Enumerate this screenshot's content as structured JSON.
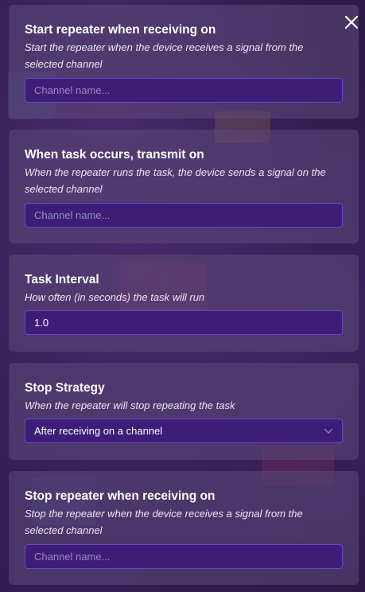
{
  "sections": [
    {
      "title": "Start repeater when receiving on",
      "description": "Start the repeater when the device receives a signal from the selected channel",
      "placeholder": "Channel name...",
      "value": ""
    },
    {
      "title": "When task occurs, transmit on",
      "description": "When the repeater runs the task, the device sends a signal on the selected channel",
      "placeholder": "Channel name...",
      "value": ""
    },
    {
      "title": "Task Interval",
      "description": "How often (in seconds) the task will run",
      "placeholder": "",
      "value": "1.0"
    },
    {
      "title": "Stop Strategy",
      "description": "When the repeater will stop repeating the task",
      "selected": "After receiving on a channel"
    },
    {
      "title": "Stop repeater when receiving on",
      "description": "Stop the repeater when the device receives a signal from the selected channel",
      "placeholder": "Channel name...",
      "value": ""
    }
  ],
  "icons": {
    "close": "close-icon",
    "dropdown": "chevron-down-icon"
  },
  "colors": {
    "panel": "#58467e",
    "field": "#3d1d78",
    "field_border": "#6b48c2",
    "placeholder": "#9a8cbd"
  }
}
